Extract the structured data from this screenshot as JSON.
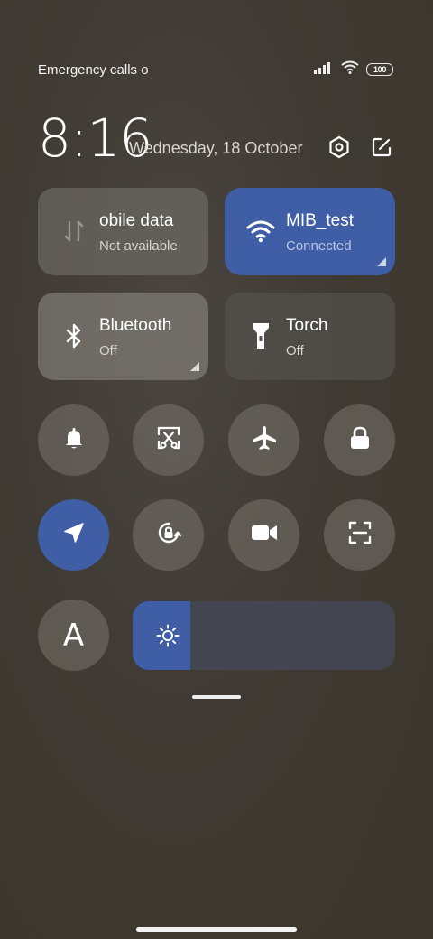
{
  "status_bar": {
    "carrier_text": "Emergency calls o",
    "battery": "100",
    "icons": [
      "signal-icon",
      "wifi-icon",
      "battery-icon"
    ]
  },
  "header": {
    "time": "8:16",
    "date": "Wednesday, 18 October",
    "icons": [
      "settings-icon",
      "edit-icon"
    ]
  },
  "tiles": {
    "mobile_data": {
      "title": "obile data",
      "subtitle": "Not available",
      "icon": "mobile-data-icon"
    },
    "wifi": {
      "title": "MIB_test",
      "subtitle": "Connected",
      "icon": "wifi-icon"
    },
    "bluetooth": {
      "title": "Bluetooth",
      "subtitle": "Off",
      "icon": "bluetooth-icon"
    },
    "torch": {
      "title": "Torch",
      "subtitle": "Off",
      "icon": "torch-icon"
    }
  },
  "toggles": [
    {
      "name": "bell-icon",
      "active": false
    },
    {
      "name": "screenshot-icon",
      "active": false
    },
    {
      "name": "airplane-icon",
      "active": false
    },
    {
      "name": "lock-icon",
      "active": false
    },
    {
      "name": "location-icon",
      "active": true
    },
    {
      "name": "rotation-lock-icon",
      "active": false
    },
    {
      "name": "video-icon",
      "active": false
    },
    {
      "name": "scan-icon",
      "active": false
    },
    {
      "name": "font-icon",
      "active": false,
      "label": "A"
    }
  ],
  "brightness": {
    "level_percent": 22,
    "icon": "sun-icon"
  },
  "colors": {
    "accent": "#3f5ea6",
    "tile_bg": "#6e6a63",
    "background": "#3d372f",
    "slider_track": "#434650"
  }
}
